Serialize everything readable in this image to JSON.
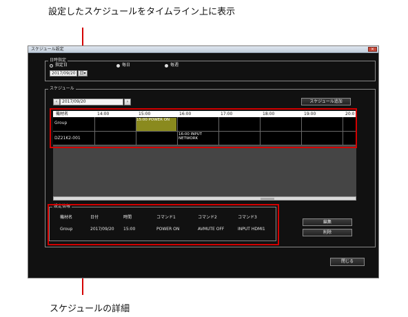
{
  "annotations": {
    "top_caption": "設定したスケジュールをタイムライン上に表示",
    "bottom_caption": "スケジュールの詳細"
  },
  "window": {
    "title": "スケジュール設定",
    "close_icon": "close-icon"
  },
  "date_spec": {
    "legend": "日時指定",
    "options": [
      {
        "label": "指定日",
        "selected": true
      },
      {
        "label": "毎日",
        "selected": false
      },
      {
        "label": "毎週",
        "selected": false
      }
    ],
    "date_value": "2017/09/20",
    "calendar_button": "日▾"
  },
  "schedule": {
    "legend": "スケジュール",
    "prev_icon": "chevron-left-icon",
    "next_icon": "chevron-right-icon",
    "date_value": "2017/09/20",
    "add_button": "スケジュール追加",
    "timeline": {
      "headers": [
        "機材名",
        "14:00",
        "15:00",
        "16:00",
        "17:00",
        "18:00",
        "19:00",
        "20:0"
      ],
      "rows": [
        {
          "device": "Group",
          "event": "15:00 POWER ON",
          "event_color": "#8a8a1e"
        },
        {
          "device": "DZ21K2-001",
          "event": "16:00 INPUT NETWORK",
          "event_color": "#000000"
        }
      ]
    }
  },
  "settings": {
    "legend": "設定情報",
    "headers": [
      "機材名",
      "日付",
      "時間",
      "コマンド1",
      "コマンド2",
      "コマンド3"
    ],
    "row": [
      "Group",
      "2017/09/20",
      "15:00",
      "POWER ON",
      "AVMUTE OFF",
      "INPUT HDMI1"
    ],
    "edit_button": "編集",
    "delete_button": "削除"
  },
  "footer": {
    "close_button": "閉じる"
  },
  "colors": {
    "highlight": "#d40000",
    "window_bg": "#111111",
    "event_power_on": "#8a8a1e"
  }
}
